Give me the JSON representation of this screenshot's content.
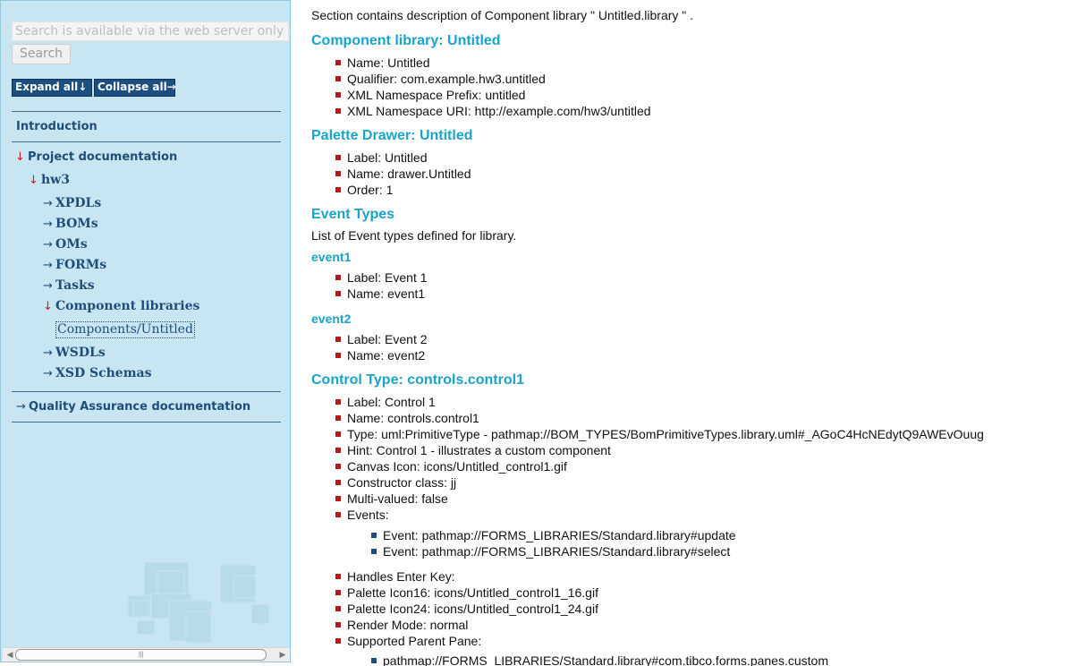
{
  "sidebar": {
    "search_placeholder": "Search is available via the web server only",
    "search_button": "Search",
    "expand_all": "Expand all↓",
    "collapse_all": "Collapse all→",
    "nav": {
      "introduction": "Introduction",
      "project_documentation": "Project documentation",
      "hw3": "hw3",
      "xpdls": "XPDLs",
      "boms": "BOMs",
      "oms": "OMs",
      "forms": "FORMs",
      "tasks": "Tasks",
      "component_libraries": "Component libraries",
      "components_untitled": "Components/Untitled",
      "wsdls": "WSDLs",
      "xsd_schemas": "XSD Schemas",
      "quality_assurance": "Quality Assurance documentation"
    }
  },
  "content": {
    "intro": "Section contains description of Component library \" Untitled.library \" .",
    "component_library": {
      "heading": "Component library: Untitled",
      "items": [
        "Name: Untitled",
        "Qualifier: com.example.hw3.untitled",
        "XML Namespace Prefix: untitled",
        "XML Namespace URI: http://example.com/hw3/untitled"
      ]
    },
    "palette_drawer": {
      "heading": "Palette Drawer: Untitled",
      "items": [
        "Label: Untitled",
        "Name: drawer.Untitled",
        "Order: 1"
      ]
    },
    "event_types": {
      "heading": "Event Types",
      "description": "List of Event types defined for library.",
      "event1": {
        "heading": "event1",
        "items": [
          "Label: Event 1",
          "Name: event1"
        ]
      },
      "event2": {
        "heading": "event2",
        "items": [
          "Label: Event 2",
          "Name: event2"
        ]
      }
    },
    "control_type": {
      "heading": "Control Type: controls.control1",
      "items": [
        "Label: Control 1",
        "Name: controls.control1",
        "Type: uml:PrimitiveType - pathmap://BOM_TYPES/BomPrimitiveTypes.library.uml#_AGoC4HcNEdytQ9AWEvOuug",
        "Hint: Control 1 - illustrates a custom component",
        "Canvas Icon: icons/Untitled_control1.gif",
        "Constructor class: jj",
        "Multi-valued: false",
        "Events:"
      ],
      "events": [
        "Event: pathmap://FORMS_LIBRARIES/Standard.library#update",
        "Event: pathmap://FORMS_LIBRARIES/Standard.library#select"
      ],
      "items_after": [
        "Handles Enter Key:",
        "Palette Icon16: icons/Untitled_control1_16.gif",
        "Palette Icon24: icons/Untitled_control1_24.gif",
        "Render Mode: normal",
        "Supported Parent Pane:"
      ],
      "parent_panes": [
        "pathmap://FORMS_LIBRARIES/Standard.library#com.tibco.forms.panes.custom"
      ]
    }
  }
}
